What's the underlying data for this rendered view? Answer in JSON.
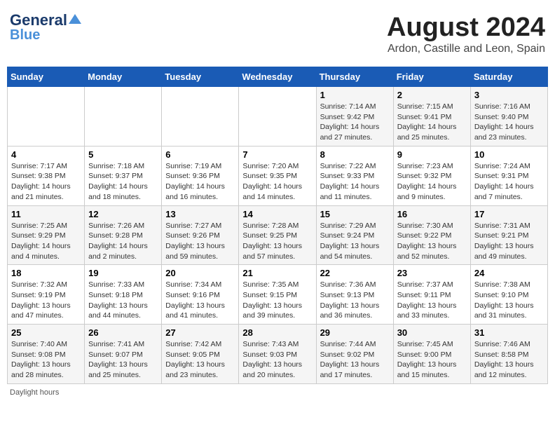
{
  "header": {
    "logo_line1": "General",
    "logo_line2": "Blue",
    "title": "August 2024",
    "subtitle": "Ardon, Castille and Leon, Spain"
  },
  "days_of_week": [
    "Sunday",
    "Monday",
    "Tuesday",
    "Wednesday",
    "Thursday",
    "Friday",
    "Saturday"
  ],
  "weeks": [
    [
      {
        "day": "",
        "info": ""
      },
      {
        "day": "",
        "info": ""
      },
      {
        "day": "",
        "info": ""
      },
      {
        "day": "",
        "info": ""
      },
      {
        "day": "1",
        "info": "Sunrise: 7:14 AM\nSunset: 9:42 PM\nDaylight: 14 hours and 27 minutes."
      },
      {
        "day": "2",
        "info": "Sunrise: 7:15 AM\nSunset: 9:41 PM\nDaylight: 14 hours and 25 minutes."
      },
      {
        "day": "3",
        "info": "Sunrise: 7:16 AM\nSunset: 9:40 PM\nDaylight: 14 hours and 23 minutes."
      }
    ],
    [
      {
        "day": "4",
        "info": "Sunrise: 7:17 AM\nSunset: 9:38 PM\nDaylight: 14 hours and 21 minutes."
      },
      {
        "day": "5",
        "info": "Sunrise: 7:18 AM\nSunset: 9:37 PM\nDaylight: 14 hours and 18 minutes."
      },
      {
        "day": "6",
        "info": "Sunrise: 7:19 AM\nSunset: 9:36 PM\nDaylight: 14 hours and 16 minutes."
      },
      {
        "day": "7",
        "info": "Sunrise: 7:20 AM\nSunset: 9:35 PM\nDaylight: 14 hours and 14 minutes."
      },
      {
        "day": "8",
        "info": "Sunrise: 7:22 AM\nSunset: 9:33 PM\nDaylight: 14 hours and 11 minutes."
      },
      {
        "day": "9",
        "info": "Sunrise: 7:23 AM\nSunset: 9:32 PM\nDaylight: 14 hours and 9 minutes."
      },
      {
        "day": "10",
        "info": "Sunrise: 7:24 AM\nSunset: 9:31 PM\nDaylight: 14 hours and 7 minutes."
      }
    ],
    [
      {
        "day": "11",
        "info": "Sunrise: 7:25 AM\nSunset: 9:29 PM\nDaylight: 14 hours and 4 minutes."
      },
      {
        "day": "12",
        "info": "Sunrise: 7:26 AM\nSunset: 9:28 PM\nDaylight: 14 hours and 2 minutes."
      },
      {
        "day": "13",
        "info": "Sunrise: 7:27 AM\nSunset: 9:26 PM\nDaylight: 13 hours and 59 minutes."
      },
      {
        "day": "14",
        "info": "Sunrise: 7:28 AM\nSunset: 9:25 PM\nDaylight: 13 hours and 57 minutes."
      },
      {
        "day": "15",
        "info": "Sunrise: 7:29 AM\nSunset: 9:24 PM\nDaylight: 13 hours and 54 minutes."
      },
      {
        "day": "16",
        "info": "Sunrise: 7:30 AM\nSunset: 9:22 PM\nDaylight: 13 hours and 52 minutes."
      },
      {
        "day": "17",
        "info": "Sunrise: 7:31 AM\nSunset: 9:21 PM\nDaylight: 13 hours and 49 minutes."
      }
    ],
    [
      {
        "day": "18",
        "info": "Sunrise: 7:32 AM\nSunset: 9:19 PM\nDaylight: 13 hours and 47 minutes."
      },
      {
        "day": "19",
        "info": "Sunrise: 7:33 AM\nSunset: 9:18 PM\nDaylight: 13 hours and 44 minutes."
      },
      {
        "day": "20",
        "info": "Sunrise: 7:34 AM\nSunset: 9:16 PM\nDaylight: 13 hours and 41 minutes."
      },
      {
        "day": "21",
        "info": "Sunrise: 7:35 AM\nSunset: 9:15 PM\nDaylight: 13 hours and 39 minutes."
      },
      {
        "day": "22",
        "info": "Sunrise: 7:36 AM\nSunset: 9:13 PM\nDaylight: 13 hours and 36 minutes."
      },
      {
        "day": "23",
        "info": "Sunrise: 7:37 AM\nSunset: 9:11 PM\nDaylight: 13 hours and 33 minutes."
      },
      {
        "day": "24",
        "info": "Sunrise: 7:38 AM\nSunset: 9:10 PM\nDaylight: 13 hours and 31 minutes."
      }
    ],
    [
      {
        "day": "25",
        "info": "Sunrise: 7:40 AM\nSunset: 9:08 PM\nDaylight: 13 hours and 28 minutes."
      },
      {
        "day": "26",
        "info": "Sunrise: 7:41 AM\nSunset: 9:07 PM\nDaylight: 13 hours and 25 minutes."
      },
      {
        "day": "27",
        "info": "Sunrise: 7:42 AM\nSunset: 9:05 PM\nDaylight: 13 hours and 23 minutes."
      },
      {
        "day": "28",
        "info": "Sunrise: 7:43 AM\nSunset: 9:03 PM\nDaylight: 13 hours and 20 minutes."
      },
      {
        "day": "29",
        "info": "Sunrise: 7:44 AM\nSunset: 9:02 PM\nDaylight: 13 hours and 17 minutes."
      },
      {
        "day": "30",
        "info": "Sunrise: 7:45 AM\nSunset: 9:00 PM\nDaylight: 13 hours and 15 minutes."
      },
      {
        "day": "31",
        "info": "Sunrise: 7:46 AM\nSunset: 8:58 PM\nDaylight: 13 hours and 12 minutes."
      }
    ]
  ],
  "footer": {
    "note": "Daylight hours"
  }
}
